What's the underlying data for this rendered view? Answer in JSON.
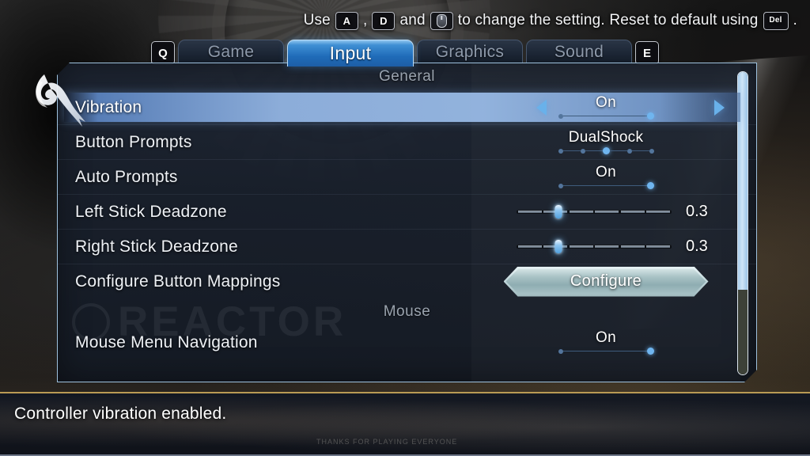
{
  "hint": {
    "prefix": "Use",
    "key_left": "A",
    "comma": ",",
    "key_right": "D",
    "and": "and",
    "mouse_icon": "mouse-icon",
    "middle": "to change the setting. Reset to default using",
    "key_reset": "Del",
    "period": "."
  },
  "tabs": {
    "prev_key": "Q",
    "next_key": "E",
    "items": [
      {
        "label": "Game",
        "active": false
      },
      {
        "label": "Input",
        "active": true
      },
      {
        "label": "Graphics",
        "active": false
      },
      {
        "label": "Sound",
        "active": false
      }
    ]
  },
  "panel": {
    "watermark": "REACTOR",
    "sections": [
      {
        "title": "General",
        "rows": [
          {
            "label": "Vibration",
            "selected": true,
            "control": "option",
            "value": "On",
            "dots_total": 2,
            "dots_index": 1,
            "arrows": true
          },
          {
            "label": "Button Prompts",
            "selected": false,
            "control": "option",
            "value": "DualShock",
            "dots_total": 5,
            "dots_index": 2,
            "arrows": false
          },
          {
            "label": "Auto Prompts",
            "selected": false,
            "control": "option",
            "value": "On",
            "dots_total": 2,
            "dots_index": 1,
            "arrows": false
          },
          {
            "label": "Left Stick Deadzone",
            "selected": false,
            "control": "slider",
            "value": "0.3",
            "percent": 27
          },
          {
            "label": "Right Stick Deadzone",
            "selected": false,
            "control": "slider",
            "value": "0.3",
            "percent": 27
          },
          {
            "label": "Configure Button Mappings",
            "selected": false,
            "control": "button",
            "value": "Configure"
          }
        ]
      },
      {
        "title": "Mouse",
        "rows": [
          {
            "label": "Mouse Menu Navigation",
            "selected": false,
            "control": "option",
            "value": "On",
            "dots_total": 2,
            "dots_index": 1,
            "arrows": false
          }
        ]
      }
    ],
    "scroll_percent": 72
  },
  "status": {
    "message": "Controller vibration enabled.",
    "signature": "THANKS FOR PLAYING EVERYONE"
  },
  "colors": {
    "accent": "#69b1ea",
    "highlight": "#92b4e2",
    "gold": "#b99a54",
    "panel_border": "#9fc2de"
  }
}
